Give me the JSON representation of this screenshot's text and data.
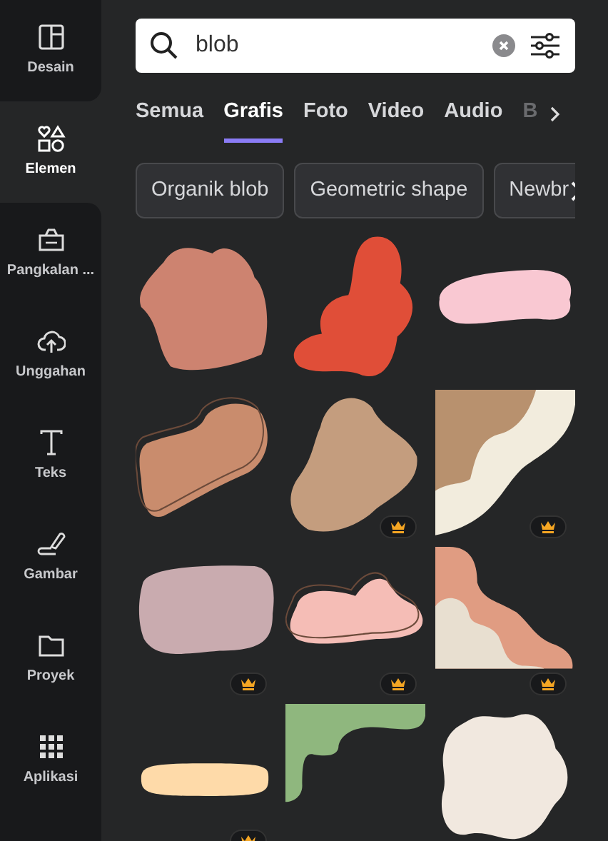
{
  "sidebar": {
    "items": [
      {
        "kind": "layout",
        "label": "Desain",
        "selected": false
      },
      {
        "kind": "shapes",
        "label": "Elemen",
        "selected": true
      },
      {
        "kind": "brand",
        "label": "Pangkalan ...",
        "selected": false
      },
      {
        "kind": "upload",
        "label": "Unggahan",
        "selected": false
      },
      {
        "kind": "text",
        "label": "Teks",
        "selected": false
      },
      {
        "kind": "draw",
        "label": "Gambar",
        "selected": false
      },
      {
        "kind": "folder",
        "label": "Proyek",
        "selected": false
      },
      {
        "kind": "apps",
        "label": "Aplikasi",
        "selected": false
      }
    ]
  },
  "search": {
    "value": "blob"
  },
  "tabs": [
    {
      "label": "Semua",
      "selected": false
    },
    {
      "label": "Grafis",
      "selected": true
    },
    {
      "label": "Foto",
      "selected": false
    },
    {
      "label": "Video",
      "selected": false
    },
    {
      "label": "Audio",
      "selected": false
    },
    {
      "label": "B",
      "selected": false
    }
  ],
  "chips": [
    "Organik blob",
    "Geometric shape",
    "Newbr"
  ],
  "items": [
    {
      "color": "#cd8370",
      "premium": false
    },
    {
      "color": "#e04e38",
      "premium": false
    },
    {
      "color": "#f9c8d2",
      "premium": false
    },
    {
      "color": "#c98c6d",
      "premium": false
    },
    {
      "color": "#c49d7e",
      "premium": true
    },
    {
      "color": "#b8916e",
      "premium": true
    },
    {
      "color": "#c9abaf",
      "premium": true
    },
    {
      "color": "#f5bdb6",
      "premium": true
    },
    {
      "color": "#e09c82",
      "premium": true
    },
    {
      "color": "#fedaa9",
      "premium": true
    },
    {
      "color": "#8fb77e",
      "premium": false
    },
    {
      "color": "#f1e8df",
      "premium": false
    }
  ]
}
